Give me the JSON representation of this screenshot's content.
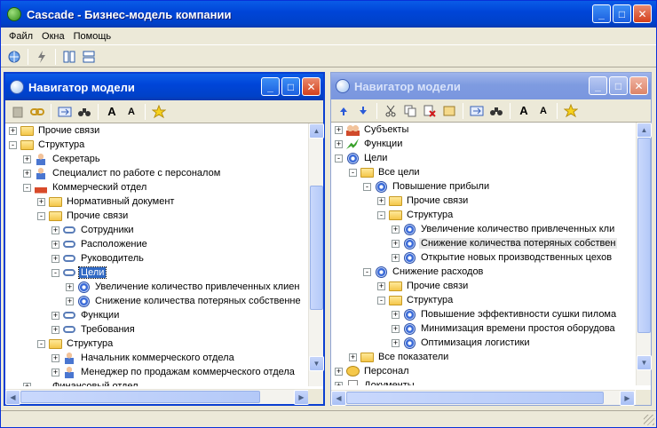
{
  "window": {
    "title": "Cascade - Бизнес-модель компании",
    "buttons": [
      "_",
      "□",
      "✕"
    ]
  },
  "menu": [
    "Файл",
    "Окна",
    "Помощь"
  ],
  "panels": [
    {
      "title": "Навигатор модели",
      "active": true,
      "toolbar_font_big": "A",
      "toolbar_font_small": "A",
      "rows": [
        {
          "indent": 0,
          "exp": "+",
          "icon": "folder",
          "label": "Прочие связи"
        },
        {
          "indent": 0,
          "exp": "-",
          "icon": "folder",
          "label": "Структура"
        },
        {
          "indent": 1,
          "exp": "+",
          "icon": "person",
          "label": "Секретарь"
        },
        {
          "indent": 1,
          "exp": "+",
          "icon": "person",
          "label": "Специалист по работе с персоналом"
        },
        {
          "indent": 1,
          "exp": "-",
          "icon": "house",
          "label": "Коммерческий отдел"
        },
        {
          "indent": 2,
          "exp": "+",
          "icon": "folder",
          "label": "Нормативный документ"
        },
        {
          "indent": 2,
          "exp": "-",
          "icon": "folder",
          "label": "Прочие связи"
        },
        {
          "indent": 3,
          "exp": "+",
          "icon": "link",
          "label": "Сотрудники"
        },
        {
          "indent": 3,
          "exp": "+",
          "icon": "link",
          "label": "Расположение"
        },
        {
          "indent": 3,
          "exp": "+",
          "icon": "link",
          "label": "Руководитель"
        },
        {
          "indent": 3,
          "exp": "-",
          "icon": "link",
          "label": "Цели",
          "selected": true
        },
        {
          "indent": 4,
          "exp": "+",
          "icon": "goal",
          "label": "Увеличение количество привлеченных клиен"
        },
        {
          "indent": 4,
          "exp": "+",
          "icon": "goal",
          "label": "Снижение количества потеряных собственне"
        },
        {
          "indent": 3,
          "exp": "+",
          "icon": "link",
          "label": "Функции"
        },
        {
          "indent": 3,
          "exp": "+",
          "icon": "link",
          "label": "Требования"
        },
        {
          "indent": 2,
          "exp": "-",
          "icon": "folder",
          "label": "Структура"
        },
        {
          "indent": 3,
          "exp": "+",
          "icon": "person",
          "label": "Начальник коммерческого отдела"
        },
        {
          "indent": 3,
          "exp": "+",
          "icon": "person",
          "label": "Менеджер по продажам коммерческого отдела"
        },
        {
          "indent": 1,
          "exp": "+",
          "icon": "house",
          "label": "Финансовый отдел"
        }
      ]
    },
    {
      "title": "Навигатор модели",
      "active": false,
      "toolbar_font_big": "A",
      "toolbar_font_small": "A",
      "rows": [
        {
          "indent": 0,
          "exp": "+",
          "icon": "group",
          "label": "Субъекты"
        },
        {
          "indent": 0,
          "exp": "+",
          "icon": "func",
          "label": "Функции"
        },
        {
          "indent": 0,
          "exp": "-",
          "icon": "goal",
          "label": "Цели"
        },
        {
          "indent": 1,
          "exp": "-",
          "icon": "folder",
          "label": "Все цели"
        },
        {
          "indent": 2,
          "exp": "-",
          "icon": "goal",
          "label": "Повышение прибыли"
        },
        {
          "indent": 3,
          "exp": "+",
          "icon": "folder",
          "label": "Прочие связи"
        },
        {
          "indent": 3,
          "exp": "-",
          "icon": "folder",
          "label": "Структура"
        },
        {
          "indent": 4,
          "exp": "+",
          "icon": "goal",
          "label": "Увеличение количество привлеченных кли"
        },
        {
          "indent": 4,
          "exp": "+",
          "icon": "goal",
          "label": "Снижение количества потеряных собствен",
          "hover": true
        },
        {
          "indent": 4,
          "exp": "+",
          "icon": "goal",
          "label": "Открытие новых производственных цехов"
        },
        {
          "indent": 2,
          "exp": "-",
          "icon": "goal",
          "label": "Снижение расходов"
        },
        {
          "indent": 3,
          "exp": "+",
          "icon": "folder",
          "label": "Прочие связи"
        },
        {
          "indent": 3,
          "exp": "-",
          "icon": "folder",
          "label": "Структура"
        },
        {
          "indent": 4,
          "exp": "+",
          "icon": "goal",
          "label": "Повышение эффективности сушки пилома"
        },
        {
          "indent": 4,
          "exp": "+",
          "icon": "goal",
          "label": "Минимизация времени простоя оборудова"
        },
        {
          "indent": 4,
          "exp": "+",
          "icon": "goal",
          "label": "Оптимизация логистики"
        },
        {
          "indent": 1,
          "exp": "+",
          "icon": "folder",
          "label": "Все показатели"
        },
        {
          "indent": 0,
          "exp": "+",
          "icon": "pers",
          "label": "Персонал"
        },
        {
          "indent": 0,
          "exp": "+",
          "icon": "doc",
          "label": "Документы"
        }
      ]
    }
  ]
}
